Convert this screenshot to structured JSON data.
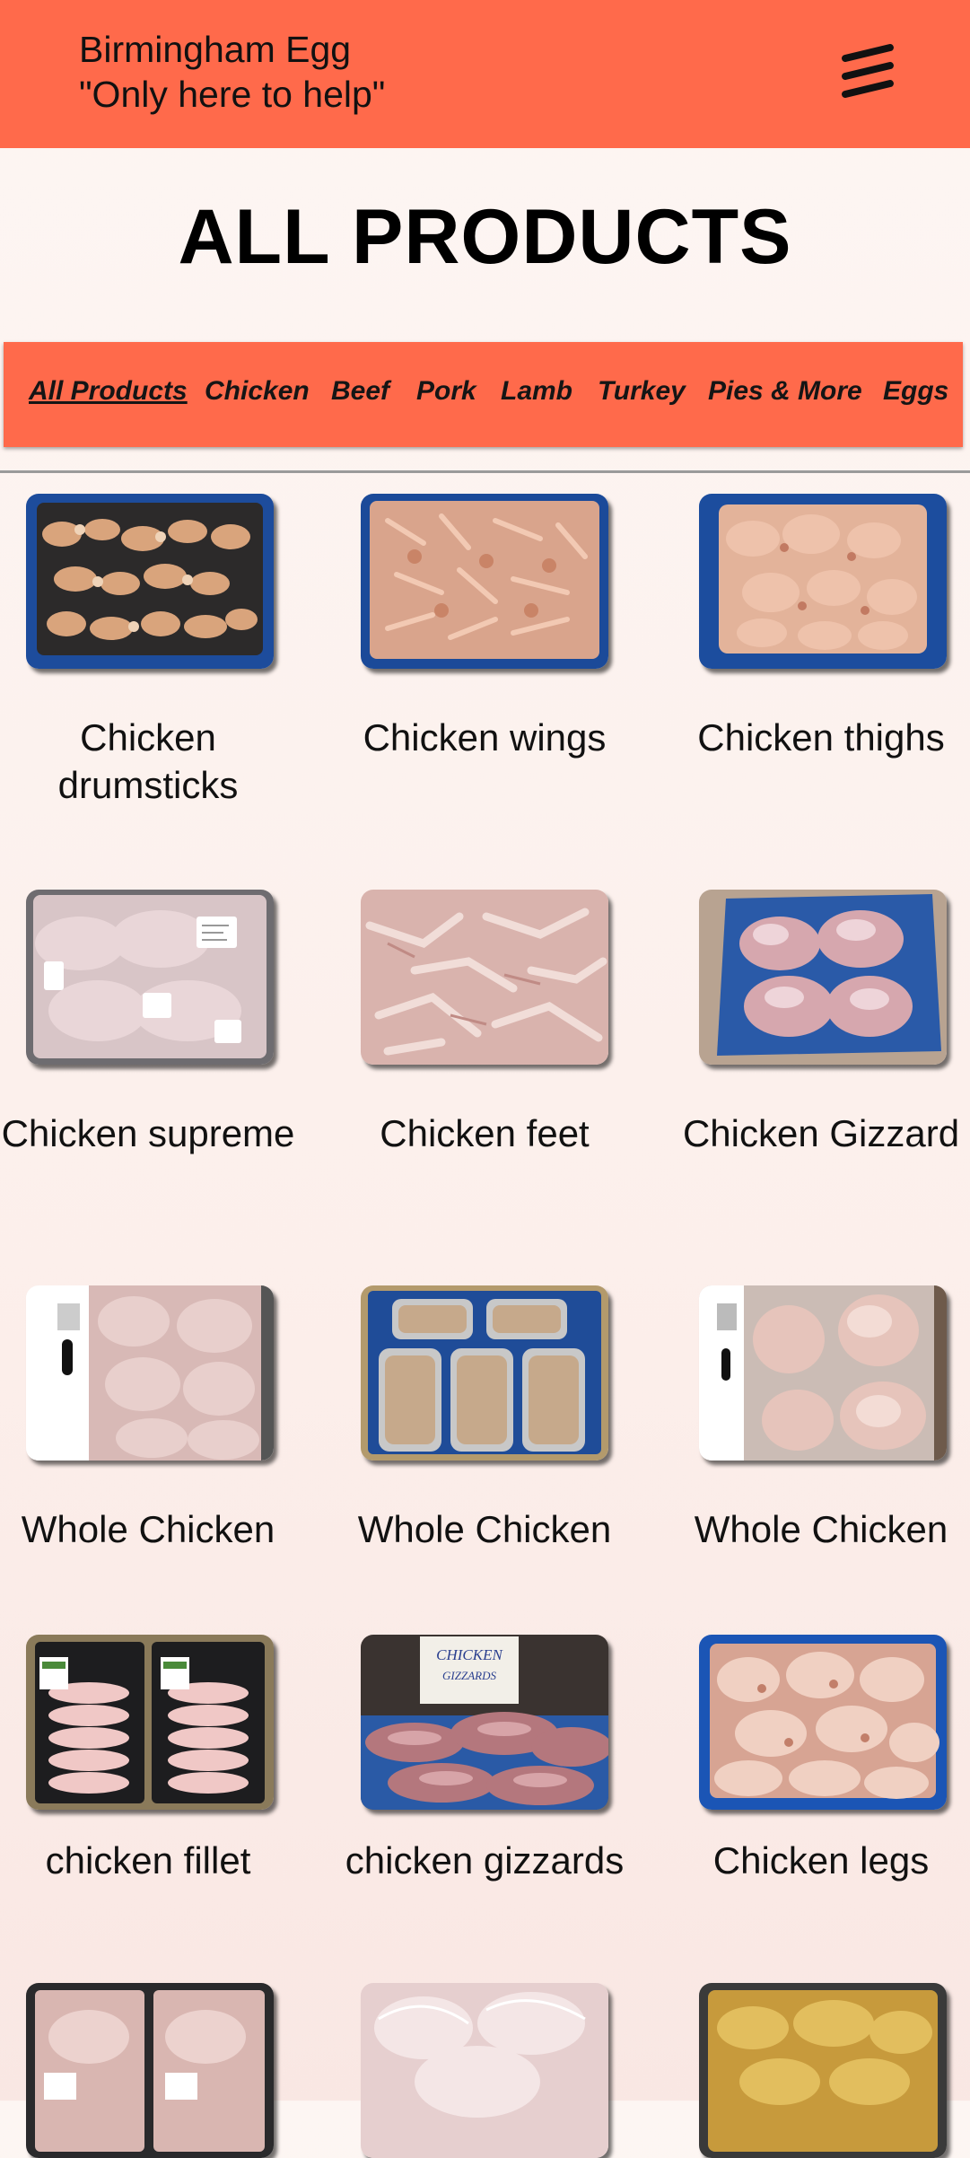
{
  "header": {
    "brand_line1": "Birmingham Egg",
    "brand_line2": "\"Only here to help\"",
    "menu_icon": "hamburger-menu-icon",
    "background_color": "#ff6a4b"
  },
  "page_title": "ALL PRODUCTS",
  "categories": [
    {
      "label": "All Products",
      "active": true
    },
    {
      "label": "Chicken",
      "active": false
    },
    {
      "label": "Beef",
      "active": false
    },
    {
      "label": "Pork",
      "active": false
    },
    {
      "label": "Lamb",
      "active": false
    },
    {
      "label": "Turkey",
      "active": false
    },
    {
      "label": "Pies & More",
      "active": false
    },
    {
      "label": "Eggs",
      "active": false
    }
  ],
  "products": [
    {
      "name": "Chicken drumsticks"
    },
    {
      "name": "Chicken wings"
    },
    {
      "name": "Chicken thighs"
    },
    {
      "name": "Chicken supreme"
    },
    {
      "name": "Chicken feet"
    },
    {
      "name": "Chicken Gizzard"
    },
    {
      "name": "Whole Chicken"
    },
    {
      "name": "Whole Chicken"
    },
    {
      "name": "Whole Chicken"
    },
    {
      "name": "chicken fillet"
    },
    {
      "name": "chicken gizzards"
    },
    {
      "name": "Chicken legs"
    }
  ],
  "photo_sign_text": "CHICKEN GIZZARDS"
}
